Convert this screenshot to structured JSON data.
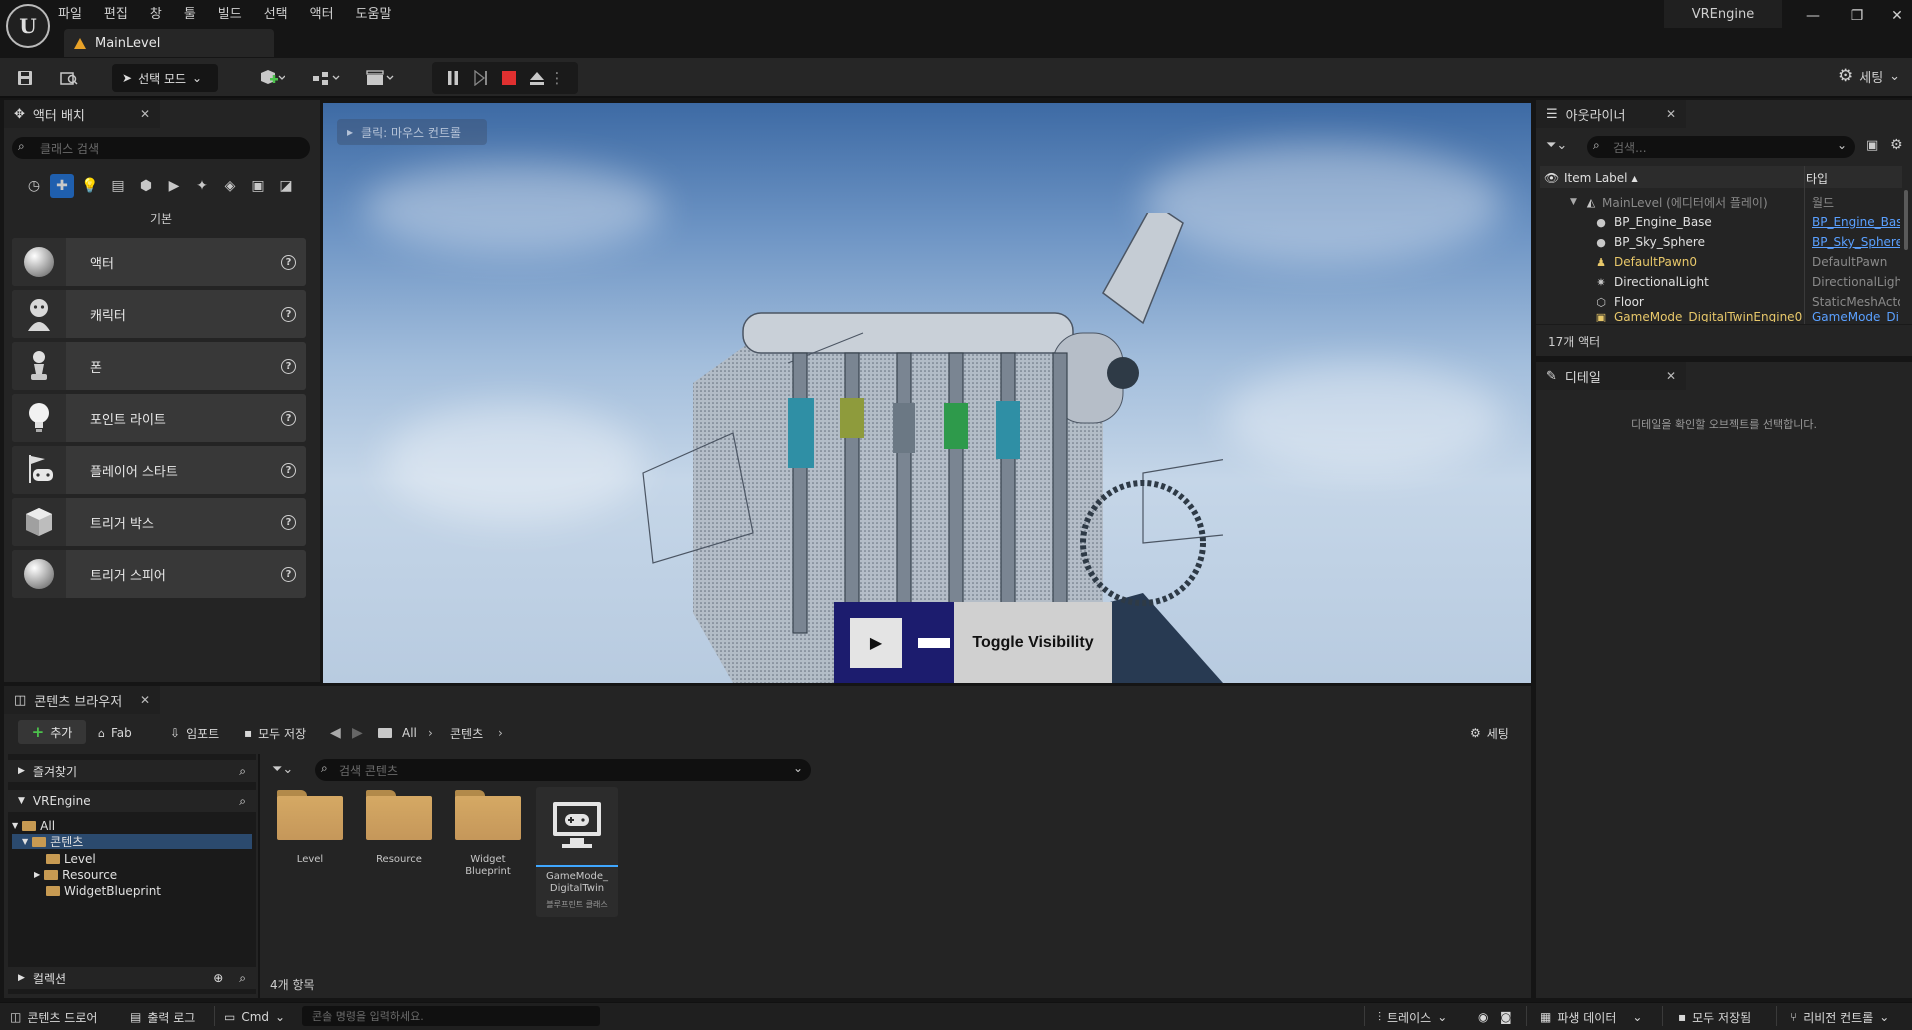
{
  "window": {
    "project_name": "VREngine",
    "level_tab": "MainLevel",
    "menu": [
      "파일",
      "편집",
      "창",
      "툴",
      "빌드",
      "선택",
      "액터",
      "도움말"
    ]
  },
  "toolbar": {
    "mode_label": "선택 모드",
    "settings_label": "세팅"
  },
  "place_actors": {
    "tab_title": "액터 배치",
    "search_placeholder": "클래스 검색",
    "category": "기본",
    "items": [
      {
        "label": "액터",
        "icon": "sphere-actor-icon"
      },
      {
        "label": "캐릭터",
        "icon": "character-icon"
      },
      {
        "label": "폰",
        "icon": "pawn-icon"
      },
      {
        "label": "포인트 라이트",
        "icon": "point-light-icon"
      },
      {
        "label": "플레이어 스타트",
        "icon": "player-start-icon"
      },
      {
        "label": "트리거 박스",
        "icon": "trigger-box-icon"
      },
      {
        "label": "트리거 스피어",
        "icon": "trigger-sphere-icon"
      }
    ]
  },
  "viewport": {
    "hint": "클릭: 마우스 컨트롤",
    "toggle_button": "Toggle Visibility"
  },
  "outliner": {
    "tab_title": "아웃라이너",
    "search_placeholder": "검색...",
    "col_label": "Item Label",
    "col_type": "타입",
    "rows": [
      {
        "label": "MainLevel (에디터에서 플레이)",
        "type": "월드",
        "link": false,
        "icon": "level-icon"
      },
      {
        "label": "BP_Engine_Base",
        "type": "BP_Engine_Bas",
        "link": true,
        "icon": "actor-icon"
      },
      {
        "label": "BP_Sky_Sphere",
        "type": "BP_Sky_Sphere",
        "link": true,
        "icon": "actor-icon"
      },
      {
        "label": "DefaultPawn0",
        "type": "DefaultPawn",
        "link": false,
        "icon": "pawn-icon"
      },
      {
        "label": "DirectionalLight",
        "type": "DirectionalLight",
        "link": false,
        "icon": "light-icon"
      },
      {
        "label": "Floor",
        "type": "StaticMeshActo",
        "link": false,
        "icon": "mesh-icon"
      },
      {
        "label": "GameMode_DigitalTwinEngine0",
        "type": "GameMode_Di",
        "link": true,
        "icon": "gamemode-icon"
      }
    ],
    "count": "17개 액터"
  },
  "details": {
    "tab_title": "디테일",
    "empty_message": "디테일을 확인할 오브젝트를 선택합니다."
  },
  "content_browser": {
    "tab_title": "콘텐츠 브라우저",
    "add": "추가",
    "fab": "Fab",
    "import": "임포트",
    "save_all": "모두 저장",
    "path_root": "All",
    "path_current": "콘텐츠",
    "settings": "세팅",
    "favorites": "즐겨찾기",
    "project": "VREngine",
    "tree": [
      "All",
      "콘텐츠",
      "Level",
      "Resource",
      "WidgetBlueprint"
    ],
    "collections": "컬렉션",
    "search_placeholder": "검색 콘텐츠",
    "assets": [
      {
        "label": "Level"
      },
      {
        "label": "Resource"
      },
      {
        "label": "Widget Blueprint"
      }
    ],
    "selected_asset": {
      "label": "GameMode_ DigitalTwin",
      "sub": "블루프린트 클래스"
    },
    "item_count": "4개 항목"
  },
  "statusbar": {
    "content_drawer": "콘텐츠 드로어",
    "output_log": "출력 로그",
    "cmd": "Cmd",
    "console_placeholder": "콘솔 명령을 입력하세요.",
    "trace": "트레이스",
    "derived_data": "파생 데이터",
    "all_saved": "모두 저장됨",
    "revision_control": "리비전 컨트롤"
  }
}
